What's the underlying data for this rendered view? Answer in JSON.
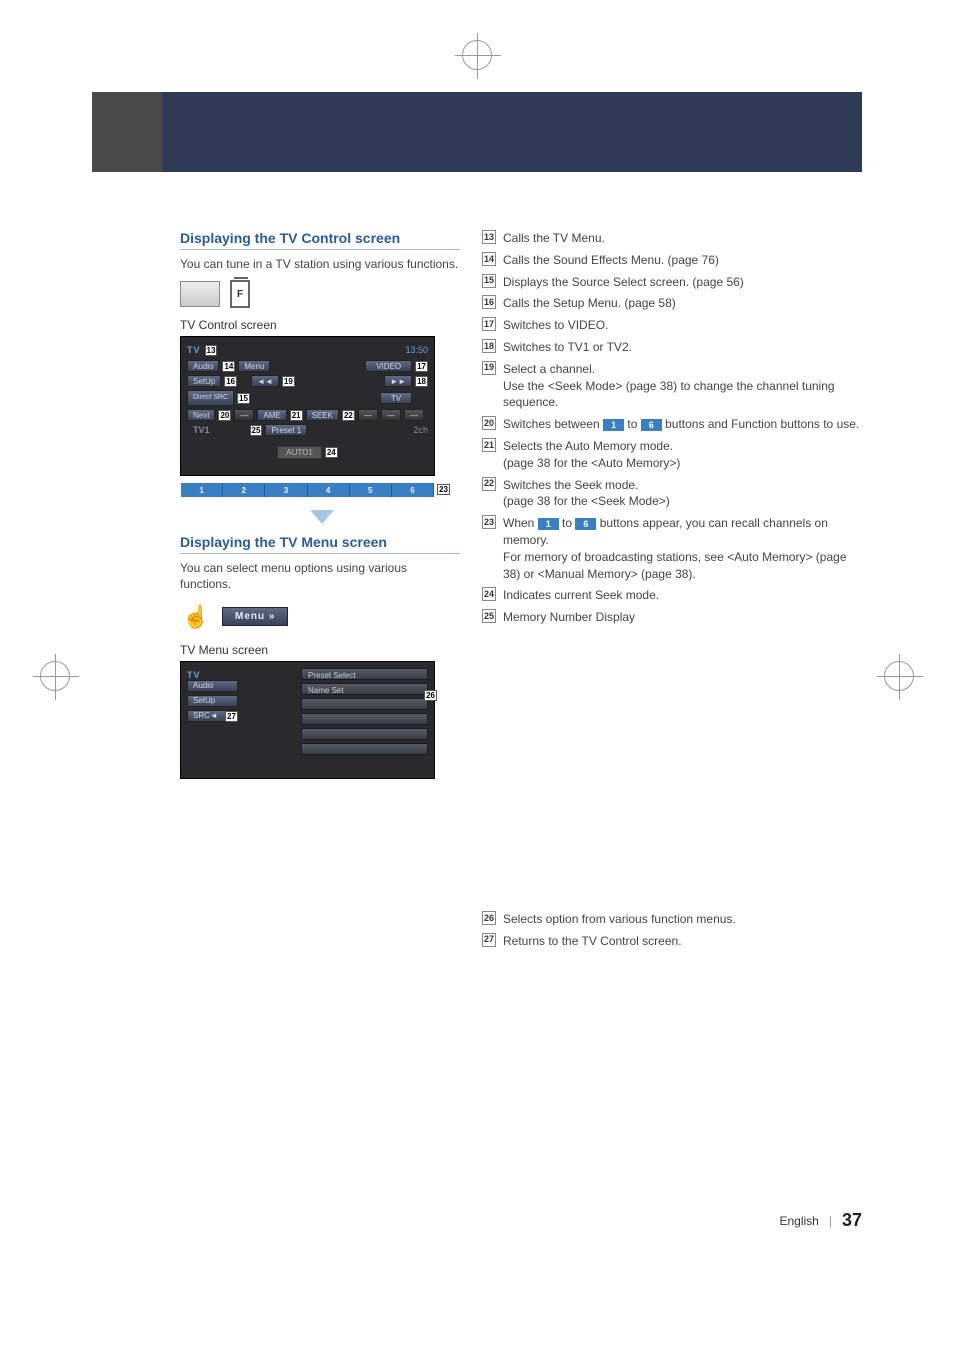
{
  "header": {},
  "sections": {
    "control": {
      "title": "Displaying the TV Control screen",
      "desc": "You can tune in a TV station using various functions.",
      "caption": "TV Control screen",
      "screen": {
        "title": "TV",
        "clock": "13:50",
        "menu_btn": "Menu",
        "audio_btn": "Audio",
        "setup_btn": "SetUp",
        "direct_src_btn": "Direct\nSRC",
        "next_btn": "Next",
        "video_btn": "VIDEO",
        "prev_btn": "◄◄",
        "fwd_btn": "►►",
        "tv_btn": "TV",
        "ame_btn": "AME",
        "seek_btn": "SEEK",
        "band_label": "TV1",
        "preset_label": "Preset 1",
        "channel_label": "2ch",
        "seek_mode": "AUTO1",
        "num_buttons": [
          "1",
          "2",
          "3",
          "4",
          "5",
          "6"
        ]
      },
      "callouts": {
        "n13": "13",
        "n14": "14",
        "n15": "15",
        "n16": "16",
        "n17": "17",
        "n18": "18",
        "n19": "19",
        "n20": "20",
        "n21": "21",
        "n22": "22",
        "n23": "23",
        "n24": "24",
        "n25": "25"
      },
      "screen_icon_label": "F"
    },
    "menu": {
      "title": "Displaying the TV Menu screen",
      "desc": "You can select menu options using various functions.",
      "button_label": "Menu",
      "caption": "TV Menu screen",
      "screen": {
        "title": "TV",
        "audio_btn": "Audio",
        "setup_btn": "SetUp",
        "src_btn": "SRC",
        "items": [
          "Preset Select",
          "Name Set"
        ]
      },
      "callouts": {
        "n26": "26",
        "n27": "27"
      }
    }
  },
  "list1": [
    {
      "n": "13",
      "t": "Calls the TV Menu."
    },
    {
      "n": "14",
      "t": "Calls the Sound Effects Menu. (page 76)"
    },
    {
      "n": "15",
      "t": "Displays the Source Select screen. (page 56)"
    },
    {
      "n": "16",
      "t": "Calls the Setup Menu. (page 58)"
    },
    {
      "n": "17",
      "t": "Switches to VIDEO."
    },
    {
      "n": "18",
      "t": "Switches to TV1 or TV2."
    },
    {
      "n": "19",
      "t": "Select a channel.\nUse the <Seek Mode> (page 38) to change the channel tuning sequence."
    },
    {
      "n": "20",
      "t": "Switches between",
      "btn1": "1",
      "mid": "to",
      "btn2": "6",
      "tail": "buttons and Function buttons to use."
    },
    {
      "n": "21",
      "t": "Selects the Auto Memory mode.\n(page 38 for the <Auto Memory>)"
    },
    {
      "n": "22",
      "t": "Switches the Seek mode.\n(page 38 for the <Seek Mode>)"
    },
    {
      "n": "23",
      "t": "When",
      "btn1": "1",
      "mid": "to",
      "btn2": "6",
      "tail": "buttons appear, you can recall channels on memory.\nFor memory of broadcasting stations, see <Auto Memory> (page 38) or <Manual Memory> (page 38)."
    },
    {
      "n": "24",
      "t": "Indicates current Seek mode."
    },
    {
      "n": "25",
      "t": "Memory Number Display"
    }
  ],
  "list2": [
    {
      "n": "26",
      "t": "Selects option from various function menus."
    },
    {
      "n": "27",
      "t": "Returns to the TV Control screen."
    }
  ],
  "footer": {
    "lang": "English",
    "page": "37"
  }
}
